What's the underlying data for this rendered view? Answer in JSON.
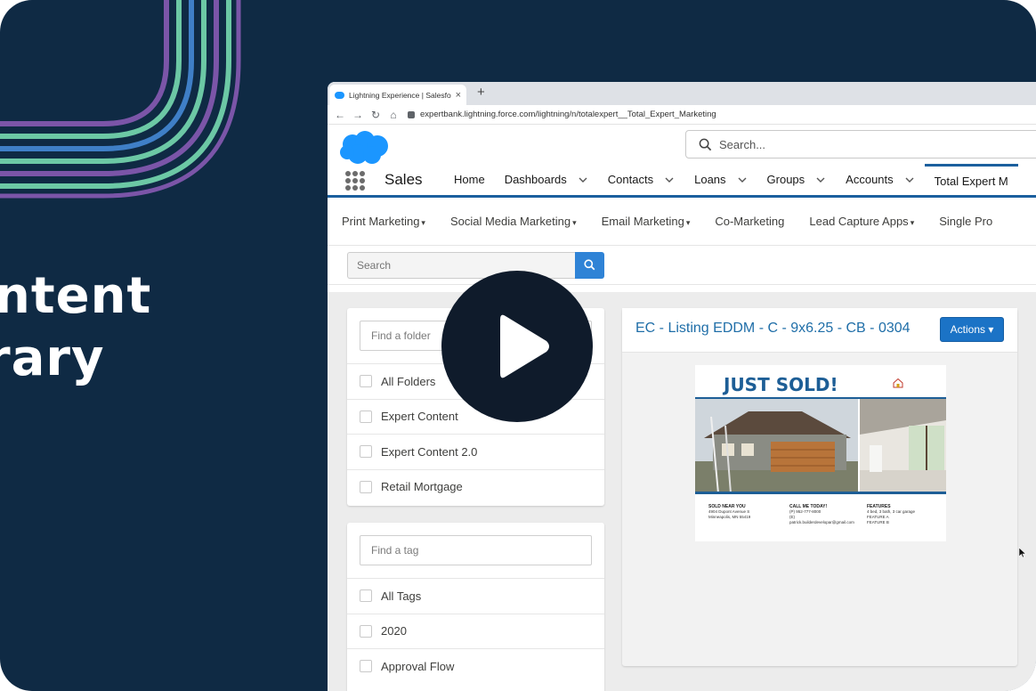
{
  "hero": {
    "line1": "ntent",
    "line2": "rary"
  },
  "browser": {
    "tab_title": "Lightning Experience | Salesfo",
    "tab_close": "×",
    "new_tab": "+",
    "url": "expertbank.lightning.force.com/lightning/n/totalexpert__Total_Expert_Marketing"
  },
  "header": {
    "search_placeholder": "Search..."
  },
  "app": {
    "name": "Sales",
    "nav": [
      {
        "label": "Home"
      },
      {
        "label": "Dashboards"
      },
      {
        "label": "Contacts"
      },
      {
        "label": "Loans"
      },
      {
        "label": "Groups"
      },
      {
        "label": "Accounts"
      },
      {
        "label": "Total Expert M"
      }
    ]
  },
  "subnav": {
    "items": [
      {
        "label": "Print Marketing",
        "caret": "▾"
      },
      {
        "label": "Social Media Marketing",
        "caret": "▾"
      },
      {
        "label": "Email Marketing",
        "caret": "▾"
      },
      {
        "label": "Co-Marketing",
        "caret": ""
      },
      {
        "label": "Lead Capture Apps",
        "caret": "▾"
      },
      {
        "label": "Single Pro",
        "caret": ""
      }
    ]
  },
  "library_search": {
    "placeholder": "Search"
  },
  "folders": {
    "find_placeholder": "Find a folder",
    "items": [
      "All Folders",
      "Expert Content",
      "Expert Content 2.0",
      "Retail Mortgage"
    ]
  },
  "tags": {
    "find_placeholder": "Find a tag",
    "items": [
      "All Tags",
      "2020",
      "Approval Flow"
    ]
  },
  "detail": {
    "title": "EC - Listing EDDM - C - 9x6.25 - CB - 0304",
    "actions_label": "Actions ▾"
  },
  "flyer": {
    "headline": "JUST SOLD!",
    "col1": {
      "heading": "SOLD NEAR YOU",
      "line1": "4904 Dupont Avenue S",
      "line2": "Minneapolis, MN 55419"
    },
    "col2": {
      "heading": "CALL ME TODAY!",
      "line1": "(P) 952-777-8000",
      "line2": "(E)",
      "line3": "patrick.builderdevelopar@gmail.com"
    },
    "col3": {
      "heading": "FEATURES",
      "line1": "4 bed, 3 bath, 3 car garage",
      "line2": "FEATURE A",
      "line3": "FEATURE B"
    }
  },
  "colors": {
    "background": "#0f2a44",
    "stripe_purple": "#7b55a8",
    "stripe_green": "#6cc8a5",
    "stripe_blue": "#3f7fc7",
    "salesforce_blue": "#1b96ff",
    "link_blue": "#1f6ea8",
    "button_blue": "#1b73c6"
  },
  "icons": {
    "play": "play-icon",
    "search": "search-icon",
    "waffle": "app-launcher-icon",
    "cloud": "salesforce-logo"
  }
}
